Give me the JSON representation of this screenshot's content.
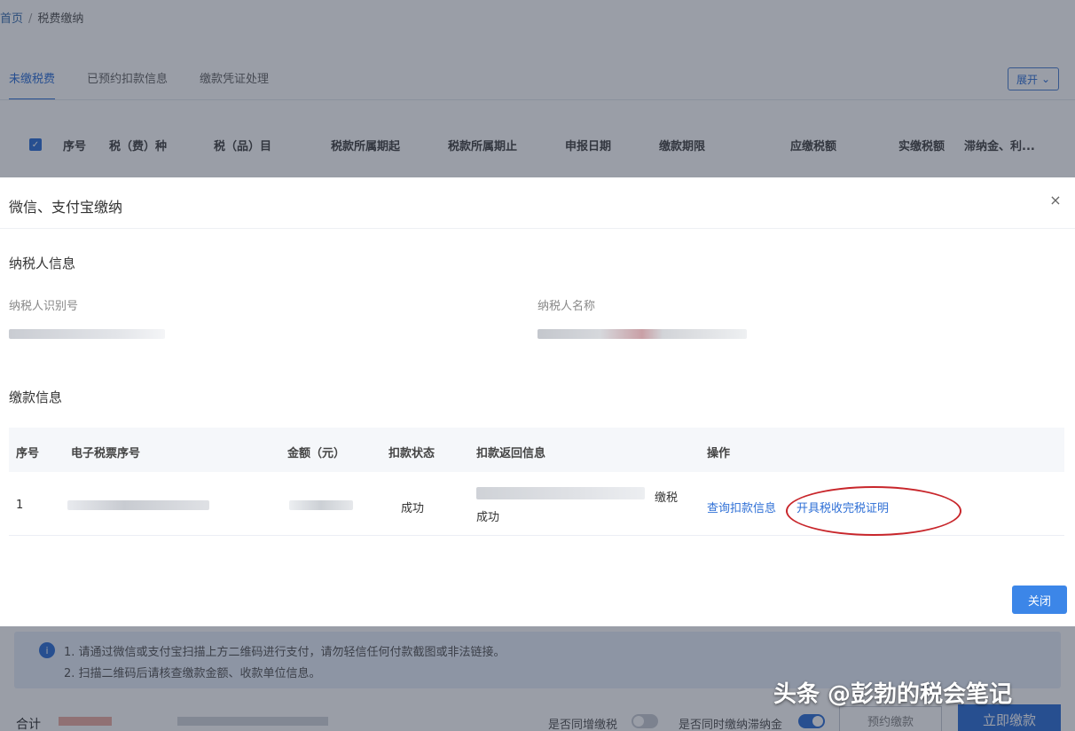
{
  "breadcrumb": {
    "home": "首页",
    "current": "税费缴纳"
  },
  "tabs": [
    "未缴税费",
    "已预约扣款信息",
    "缴款凭证处理"
  ],
  "expand_button": "展开",
  "background_table": {
    "columns": [
      "序号",
      "税（费）种",
      "税（品）目",
      "税款所属期起",
      "税款所属期止",
      "申报日期",
      "缴款期限",
      "应缴税额",
      "实缴税额",
      "滞纳金、利..."
    ]
  },
  "dialog": {
    "title": "微信、支付宝缴纳",
    "taxpayer_section": "纳税人信息",
    "taxpayer_id_label": "纳税人识别号",
    "taxpayer_name_label": "纳税人名称",
    "payment_section": "缴款信息",
    "table": {
      "headers": [
        "序号",
        "电子税票序号",
        "金额（元）",
        "扣款状态",
        "扣款返回信息",
        "操作"
      ],
      "rows": [
        {
          "index": "1",
          "status": "成功",
          "return_suffix": "缴税",
          "return_line2": "成功",
          "action_query": "查询扣款信息",
          "action_certificate": "开具税收完税证明"
        }
      ]
    },
    "close_button": "关闭"
  },
  "notice": {
    "line1": "1. 请通过微信或支付宝扫描上方二维码进行支付，请勿轻信任何付款截图或非法链接。",
    "line2": "2. 扫描二维码后请核查缴款金额、收款单位信息。"
  },
  "footer": {
    "total_label": "合计",
    "question1": "是否同增缴税",
    "question2": "是否同时缴纳滞纳金",
    "preorder_button": "预约缴款",
    "pay_button": "立即缴款"
  },
  "watermark": "头条 @彭勃的税会笔记",
  "colors": {
    "primary": "#2e6fd6",
    "annotation": "#c8262b"
  }
}
